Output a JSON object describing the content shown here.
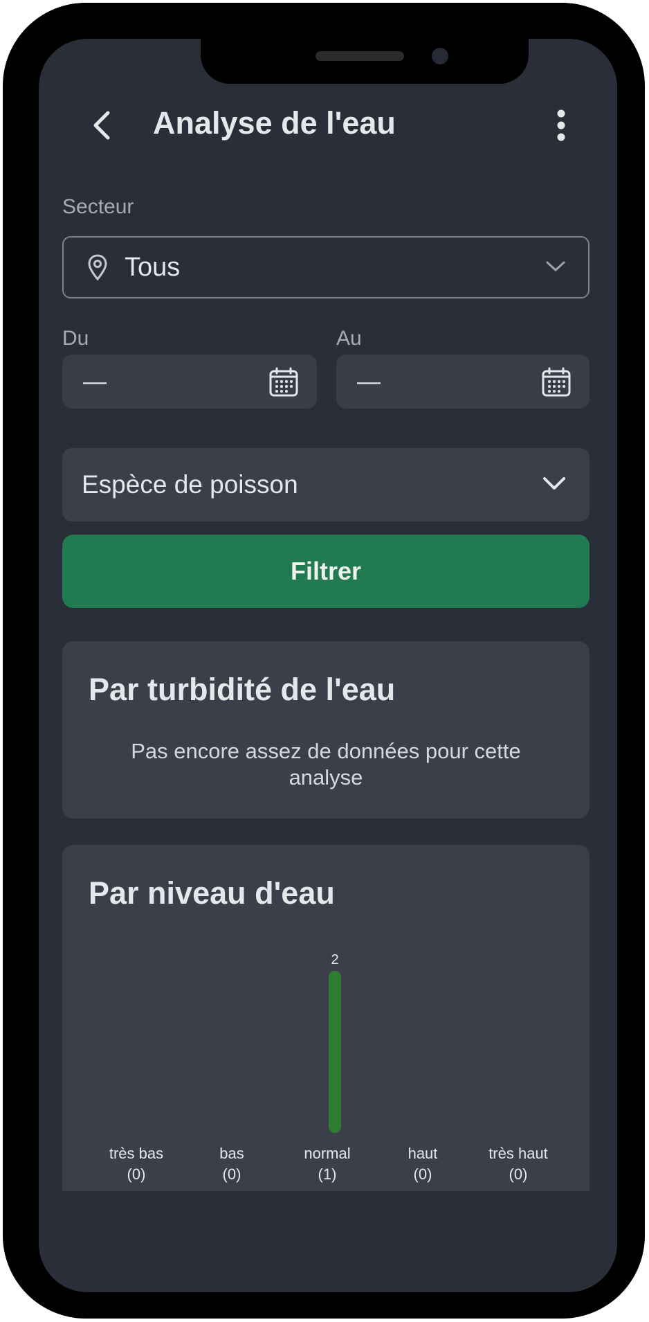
{
  "header": {
    "title": "Analyse de l'eau",
    "back_icon": "chevron-left-icon",
    "menu_icon": "more-vertical-icon"
  },
  "filters": {
    "sector_label": "Secteur",
    "sector_value": "Tous",
    "from_label": "Du",
    "from_value": "—",
    "to_label": "Au",
    "to_value": "—",
    "species_placeholder": "Espèce de poisson",
    "filter_button": "Filtrer"
  },
  "turbidity_card": {
    "title": "Par turbidité de l'eau",
    "message": "Pas encore assez de données pour cette analyse"
  },
  "water_level_card": {
    "title": "Par niveau d'eau"
  },
  "colors": {
    "background": "#2a2e38",
    "card": "#3b3f4a",
    "accent_green": "#227a50",
    "bar_green": "#2e7d32"
  },
  "chart_data": {
    "type": "bar",
    "title": "Par niveau d'eau",
    "categories": [
      "très bas",
      "bas",
      "normal",
      "haut",
      "très haut"
    ],
    "counts_labels": [
      "(0)",
      "(0)",
      "(1)",
      "(0)",
      "(0)"
    ],
    "values": [
      0,
      0,
      2,
      0,
      0
    ],
    "data_labels": [
      "",
      "",
      "2",
      "",
      ""
    ],
    "xlabel": "",
    "ylabel": "",
    "ylim": [
      0,
      2
    ],
    "grid": false,
    "legend": "none"
  }
}
